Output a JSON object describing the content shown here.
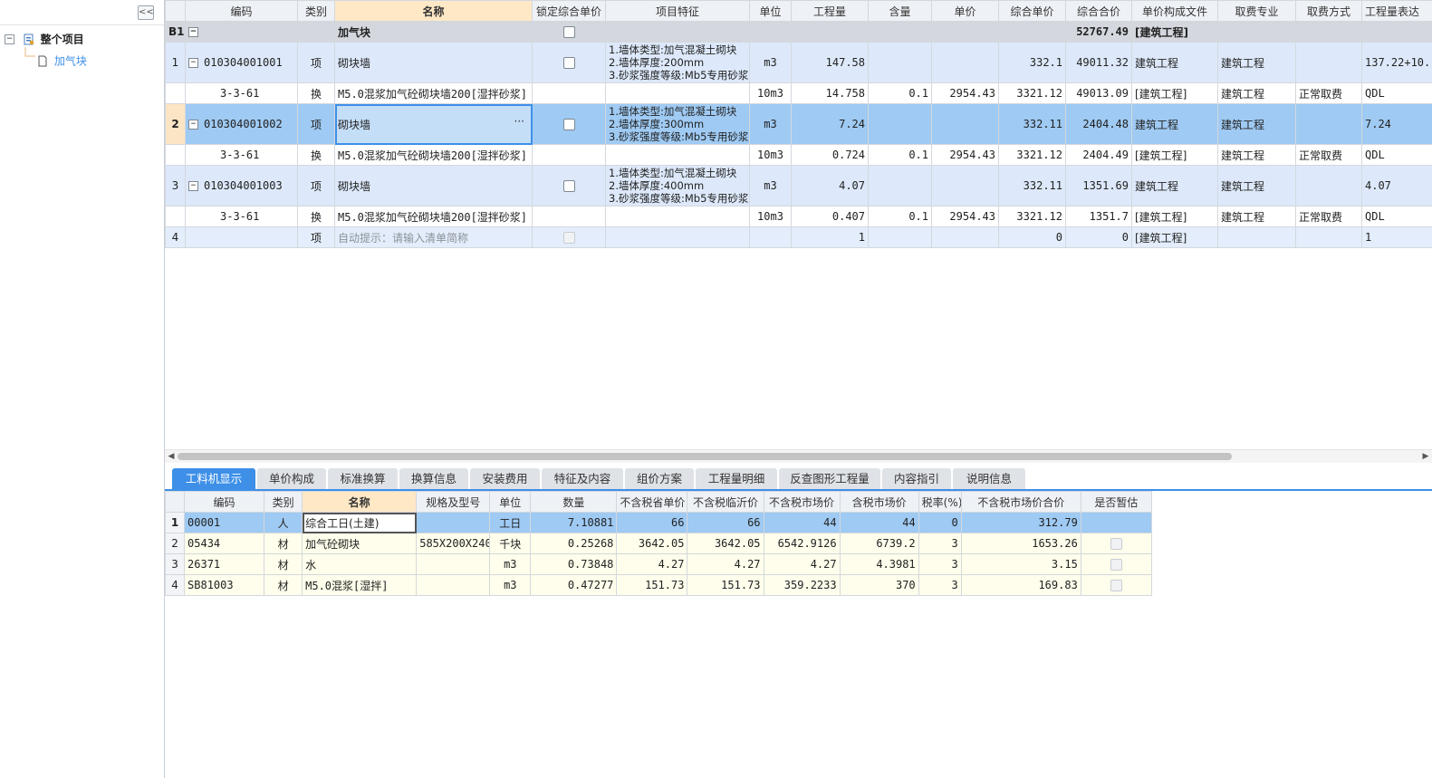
{
  "tree": {
    "root_label": "整个项目",
    "child_label": "加气块",
    "collapse_glyph": "<<",
    "root_toggle": "−"
  },
  "upper_grid": {
    "columns": [
      "编码",
      "类别",
      "名称",
      "锁定综合单价",
      "项目特征",
      "单位",
      "工程量",
      "含量",
      "单价",
      "综合单价",
      "综合合价",
      "单价构成文件",
      "取费专业",
      "取费方式",
      "工程量表达"
    ],
    "group_row": {
      "row_label": "B1",
      "name": "加气块",
      "total": "52767.49",
      "file": "[建筑工程]"
    },
    "items": [
      {
        "no": "1",
        "code": "010304001001",
        "type": "项",
        "name": "砌块墙",
        "feature": "1.墙体类型:加气混凝土砌块\n2.墙体厚度:200mm\n3.砂浆强度等级:Mb5专用砂浆",
        "unit": "m3",
        "qty": "147.58",
        "content": "",
        "price": "",
        "unit_price": "332.1",
        "total": "49011.32",
        "file": "建筑工程",
        "spec": "建筑工程",
        "method": "",
        "expr": "137.22+10.",
        "sub": {
          "code": "3-3-61",
          "type": "换",
          "name": "M5.0混浆加气砼砌块墙200[湿拌砂浆]",
          "unit": "10m3",
          "qty": "14.758",
          "content": "0.1",
          "price": "2954.43",
          "unit_price": "3321.12",
          "total": "49013.09",
          "file": "[建筑工程]",
          "spec": "建筑工程",
          "method": "正常取费",
          "expr": "QDL"
        }
      },
      {
        "no": "2",
        "code": "010304001002",
        "type": "项",
        "name": "砌块墙",
        "feature": "1.墙体类型:加气混凝土砌块\n2.墙体厚度:300mm\n3.砂浆强度等级:Mb5专用砂浆",
        "unit": "m3",
        "qty": "7.24",
        "content": "",
        "price": "",
        "unit_price": "332.11",
        "total": "2404.48",
        "file": "建筑工程",
        "spec": "建筑工程",
        "method": "",
        "expr": "7.24",
        "sub": {
          "code": "3-3-61",
          "type": "换",
          "name": "M5.0混浆加气砼砌块墙200[湿拌砂浆]",
          "unit": "10m3",
          "qty": "0.724",
          "content": "0.1",
          "price": "2954.43",
          "unit_price": "3321.12",
          "total": "2404.49",
          "file": "[建筑工程]",
          "spec": "建筑工程",
          "method": "正常取费",
          "expr": "QDL"
        }
      },
      {
        "no": "3",
        "code": "010304001003",
        "type": "项",
        "name": "砌块墙",
        "feature": "1.墙体类型:加气混凝土砌块\n2.墙体厚度:400mm\n3.砂浆强度等级:Mb5专用砂浆",
        "unit": "m3",
        "qty": "4.07",
        "content": "",
        "price": "",
        "unit_price": "332.11",
        "total": "1351.69",
        "file": "建筑工程",
        "spec": "建筑工程",
        "method": "",
        "expr": "4.07",
        "sub": {
          "code": "3-3-61",
          "type": "换",
          "name": "M5.0混浆加气砼砌块墙200[湿拌砂浆]",
          "unit": "10m3",
          "qty": "0.407",
          "content": "0.1",
          "price": "2954.43",
          "unit_price": "3321.12",
          "total": "1351.7",
          "file": "[建筑工程]",
          "spec": "建筑工程",
          "method": "正常取费",
          "expr": "QDL"
        }
      }
    ],
    "hint_row": {
      "no": "4",
      "type": "项",
      "placeholder": "自动提示：请输入清单简称",
      "qty": "1",
      "unit_price": "0",
      "total": "0",
      "file": "[建筑工程]",
      "expr": "1"
    },
    "edit_dots": "···"
  },
  "tabs": [
    "工料机显示",
    "单价构成",
    "标准换算",
    "换算信息",
    "安装费用",
    "特征及内容",
    "组价方案",
    "工程量明细",
    "反查图形工程量",
    "内容指引",
    "说明信息"
  ],
  "active_tab": 0,
  "lower_grid": {
    "columns": [
      "编码",
      "类别",
      "名称",
      "规格及型号",
      "单位",
      "数量",
      "不含税省单价",
      "不含税临沂价",
      "不含税市场价",
      "含税市场价",
      "税率(%)",
      "不含税市场价合价",
      "是否暂估"
    ],
    "rows": [
      {
        "no": "1",
        "code": "00001",
        "type": "人",
        "name": "综合工日(土建)",
        "spec": "",
        "unit": "工日",
        "qty": "7.10881",
        "prov": "66",
        "local": "66",
        "market": "44",
        "market_tax": "44",
        "rate": "0",
        "sum": "312.79",
        "est": false
      },
      {
        "no": "2",
        "code": "05434",
        "type": "材",
        "name": "加气砼砌块",
        "spec": "585X200X240",
        "unit": "千块",
        "qty": "0.25268",
        "prov": "3642.05",
        "local": "3642.05",
        "market": "6542.9126",
        "market_tax": "6739.2",
        "rate": "3",
        "sum": "1653.26",
        "est": true
      },
      {
        "no": "3",
        "code": "26371",
        "type": "材",
        "name": "水",
        "spec": "",
        "unit": "m3",
        "qty": "0.73848",
        "prov": "4.27",
        "local": "4.27",
        "market": "4.27",
        "market_tax": "4.3981",
        "rate": "3",
        "sum": "3.15",
        "est": true
      },
      {
        "no": "4",
        "code": "SB81003",
        "type": "材",
        "name": "M5.0混浆[湿拌]",
        "spec": "",
        "unit": "m3",
        "qty": "0.47277",
        "prov": "151.73",
        "local": "151.73",
        "market": "359.2233",
        "market_tax": "370",
        "rate": "3",
        "sum": "169.83",
        "est": true
      }
    ]
  },
  "colors": {
    "accent": "#3d8fe8",
    "selected_row": "#9fcaf3",
    "item_row": "#dde9fa",
    "header_highlight": "#ffe8c6",
    "lower_bg": "#fffdeb"
  }
}
